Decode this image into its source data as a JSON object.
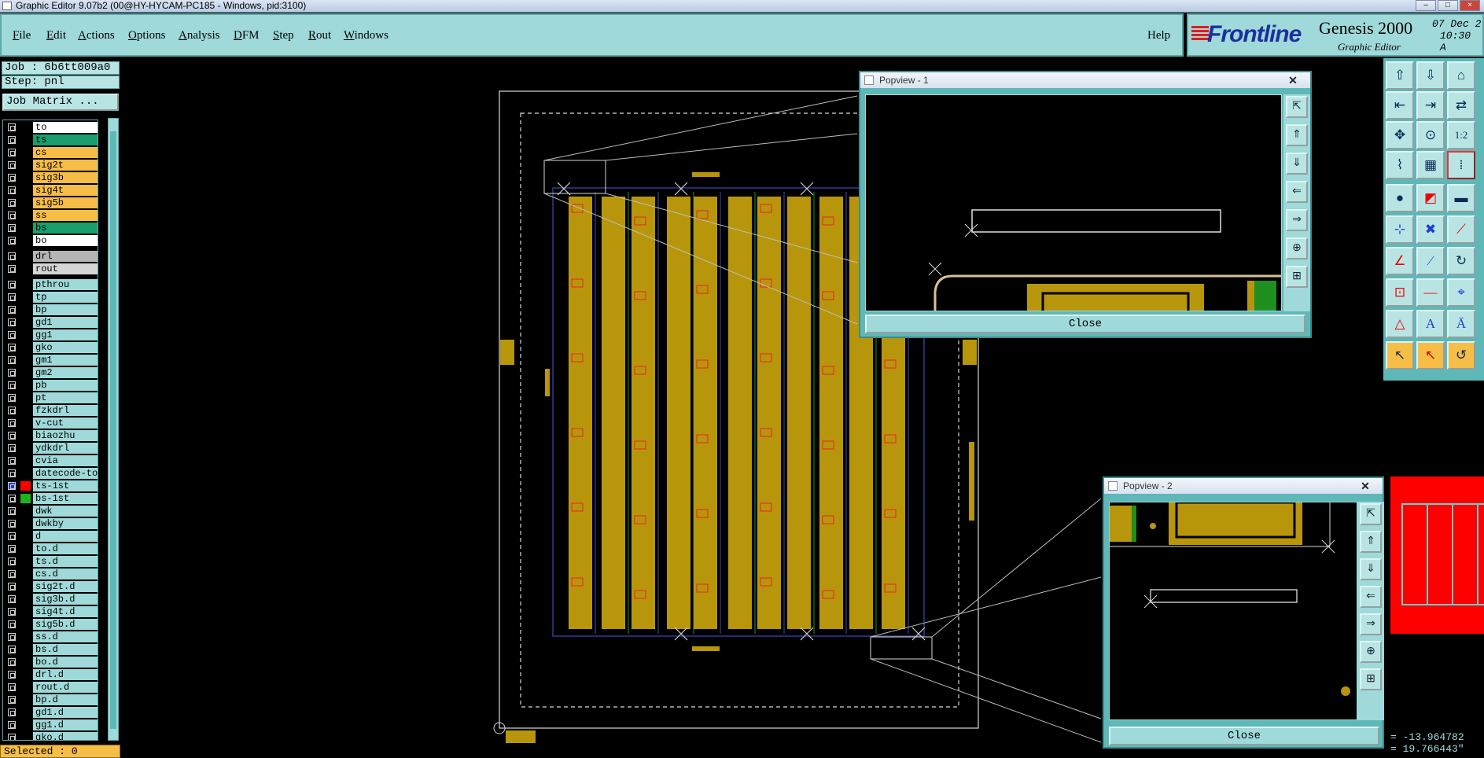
{
  "window": {
    "title": "Graphic Editor 9.07b2 (00@HY-HYCAM-PC185 - Windows, pid:3100)"
  },
  "menu": {
    "items": [
      "File",
      "Edit",
      "Actions",
      "Options",
      "Analysis",
      "DFM",
      "Step",
      "Rout",
      "Windows"
    ],
    "help": "Help"
  },
  "brand": {
    "logo": "Frontline",
    "product": "Genesis 2000",
    "subtitle": "Graphic Editor",
    "date": "07 Dec 2",
    "time": "10:30 A"
  },
  "job": {
    "job_label": "Job : 6b6tt009a0",
    "step_label": "Step: pnl",
    "matrix_button": "Job Matrix ..."
  },
  "layers": [
    {
      "name": "to",
      "color": "#ffffff"
    },
    {
      "name": "ts",
      "color": "#1b9e6e"
    },
    {
      "name": "cs",
      "color": "#f6bd47"
    },
    {
      "name": "sig2t",
      "color": "#f6bd47"
    },
    {
      "name": "sig3b",
      "color": "#f6bd47"
    },
    {
      "name": "sig4t",
      "color": "#f6bd47"
    },
    {
      "name": "sig5b",
      "color": "#f6bd47"
    },
    {
      "name": "ss",
      "color": "#f6bd47"
    },
    {
      "name": "bs",
      "color": "#1b9e6e"
    },
    {
      "name": "bo",
      "color": "#ffffff"
    },
    {
      "name": "drl",
      "color": "#b5b5b5"
    },
    {
      "name": "rout",
      "color": "#d5d5d5"
    },
    {
      "name": "pthrou",
      "color": "#9fd9d9"
    },
    {
      "name": "tp",
      "color": "#9fd9d9"
    },
    {
      "name": "bp",
      "color": "#9fd9d9"
    },
    {
      "name": "gd1",
      "color": "#9fd9d9"
    },
    {
      "name": "gg1",
      "color": "#9fd9d9"
    },
    {
      "name": "gko",
      "color": "#9fd9d9"
    },
    {
      "name": "gm1",
      "color": "#9fd9d9"
    },
    {
      "name": "gm2",
      "color": "#9fd9d9"
    },
    {
      "name": "pb",
      "color": "#9fd9d9"
    },
    {
      "name": "pt",
      "color": "#9fd9d9"
    },
    {
      "name": "fzkdrl",
      "color": "#9fd9d9"
    },
    {
      "name": "v-cut",
      "color": "#9fd9d9"
    },
    {
      "name": "biaozhu",
      "color": "#9fd9d9"
    },
    {
      "name": "ydkdrl",
      "color": "#9fd9d9"
    },
    {
      "name": "cvia",
      "color": "#9fd9d9"
    },
    {
      "name": "datecode-to",
      "color": "#9fd9d9"
    },
    {
      "name": "ts-1st",
      "color": "#9fd9d9",
      "swatch": "#ff0000",
      "active": true
    },
    {
      "name": "bs-1st",
      "color": "#9fd9d9",
      "swatch": "#1db31d"
    },
    {
      "name": "dwk",
      "color": "#9fd9d9"
    },
    {
      "name": "dwkby",
      "color": "#9fd9d9"
    },
    {
      "name": "d",
      "color": "#9fd9d9"
    },
    {
      "name": "to.d",
      "color": "#9fd9d9"
    },
    {
      "name": "ts.d",
      "color": "#9fd9d9"
    },
    {
      "name": "cs.d",
      "color": "#9fd9d9"
    },
    {
      "name": "sig2t.d",
      "color": "#9fd9d9"
    },
    {
      "name": "sig3b.d",
      "color": "#9fd9d9"
    },
    {
      "name": "sig4t.d",
      "color": "#9fd9d9"
    },
    {
      "name": "sig5b.d",
      "color": "#9fd9d9"
    },
    {
      "name": "ss.d",
      "color": "#9fd9d9"
    },
    {
      "name": "bs.d",
      "color": "#9fd9d9"
    },
    {
      "name": "bo.d",
      "color": "#9fd9d9"
    },
    {
      "name": "drl.d",
      "color": "#9fd9d9"
    },
    {
      "name": "rout.d",
      "color": "#9fd9d9"
    },
    {
      "name": "bp.d",
      "color": "#9fd9d9"
    },
    {
      "name": "gd1.d",
      "color": "#9fd9d9"
    },
    {
      "name": "gg1.d",
      "color": "#9fd9d9"
    },
    {
      "name": "gko.d",
      "color": "#9fd9d9"
    }
  ],
  "status": {
    "selected": "Selected : 0"
  },
  "popview1": {
    "title": "Popview - 1",
    "close": "Close"
  },
  "popview2": {
    "title": "Popview - 2",
    "close": "Close"
  },
  "coords": {
    "x": "= -13.964782",
    "y": "= 19.766443\""
  },
  "colors": {
    "panel": "#9fd9d9",
    "copper": "#b8960c",
    "layer_orange": "#f6bd47",
    "red_layer": "#ff0000"
  }
}
